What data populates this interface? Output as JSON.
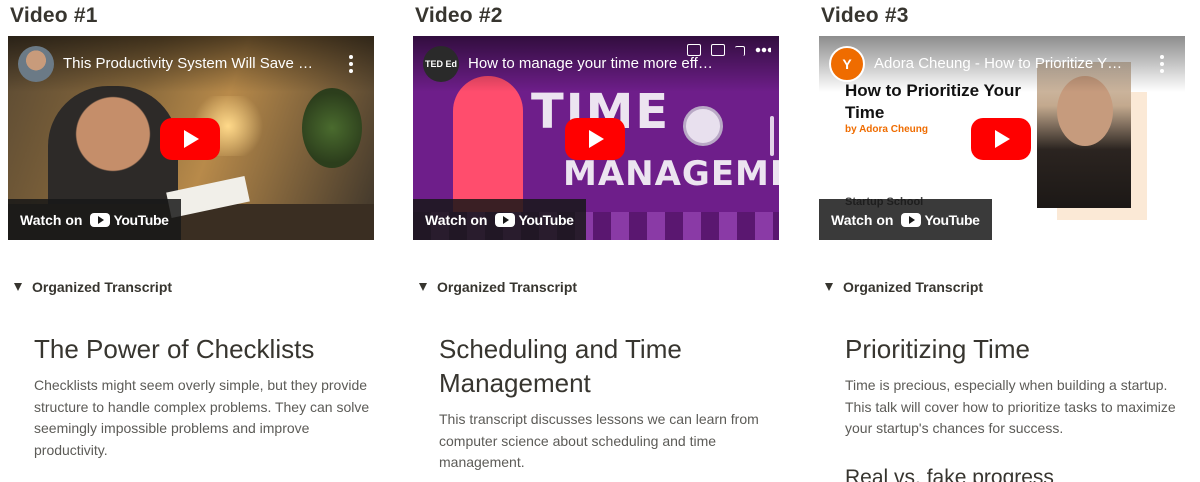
{
  "videos": [
    {
      "heading": "Video #1",
      "embed_title": "This Productivity System Will Save …",
      "watch_on": "Watch on",
      "youtube": "YouTube",
      "toggle_label": "Organized Transcript",
      "section_title": "The Power of Checklists",
      "section_body": "Checklists might seem overly simple, but they provide structure to handle complex problems. They can solve seemingly impossible problems and improve productivity."
    },
    {
      "heading": "Video #2",
      "embed_title": "How to manage your time more eff…",
      "channel_badge": "TED Ed",
      "thumb_text_1": "TIME",
      "thumb_text_2": "MANAGEMENT",
      "watch_on": "Watch on",
      "youtube": "YouTube",
      "toggle_label": "Organized Transcript",
      "section_title": "Scheduling and Time Management",
      "section_body": "This transcript discusses lessons we can learn from computer science about scheduling and time management."
    },
    {
      "heading": "Video #3",
      "embed_title": "Adora Cheung - How to Prioritize Y…",
      "channel_badge": "Y",
      "thumb_title": "How to Prioritize Your Time",
      "thumb_author": "by Adora Cheung",
      "thumb_footer": "Startup School",
      "watch_on": "Watch on",
      "youtube": "YouTube",
      "toggle_label": "Organized Transcript",
      "section_title": "Prioritizing Time",
      "section_body": "Time is precious, especially when building a startup. This talk will cover how to prioritize tasks to maximize your startup's chances for success.",
      "subheading": "Real vs. fake progress"
    }
  ],
  "colors": {
    "youtube_red": "#ff0000",
    "text": "#37352f",
    "muted_text": "#5c5b57",
    "ycombinator_orange": "#ef6c00"
  },
  "icons": [
    "play-icon",
    "more-vertical-icon",
    "youtube-logo-icon",
    "toggle-triangle-icon"
  ]
}
